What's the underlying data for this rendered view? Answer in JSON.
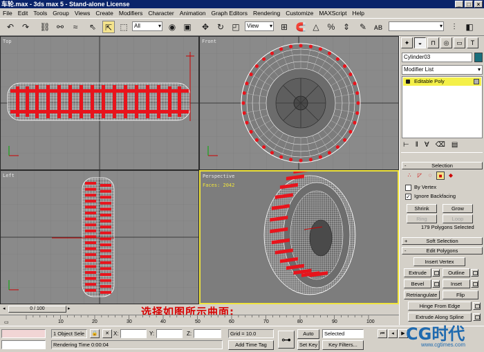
{
  "window": {
    "title": "车轮.max - 3ds max 5 - Stand-alone License",
    "controls": [
      "_",
      "□",
      "×"
    ]
  },
  "menu": [
    "File",
    "Edit",
    "Tools",
    "Group",
    "Views",
    "Create",
    "Modifiers",
    "Character",
    "Animation",
    "Graph Editors",
    "Rendering",
    "Customize",
    "MAXScript",
    "Help"
  ],
  "toolbar": {
    "selection_filter": "All",
    "reference_coord": "View"
  },
  "viewports": {
    "top": {
      "label": "Top"
    },
    "front": {
      "label": "Front"
    },
    "left": {
      "label": "Left"
    },
    "perspective": {
      "label": "Perspective",
      "faces": "Faces: 2042"
    }
  },
  "command_panel": {
    "object_name": "Cylinder03",
    "object_color": "#1a6f7c",
    "modifier_list": "Modifier List",
    "stack_item": "Editable Poly",
    "selection": {
      "title": "Selection",
      "by_vertex": "By Vertex",
      "by_vertex_checked": false,
      "ignore_backfacing": "Ignore Backfacing",
      "ignore_backfacing_checked": true,
      "shrink": "Shrink",
      "grow": "Grow",
      "ring": "Ring",
      "loop": "Loop",
      "status": "179 Polygons Selected"
    },
    "soft_selection": "Soft Selection",
    "edit_polygons": {
      "title": "Edit Polygons",
      "insert_vertex": "Insert Vertex",
      "extrude": "Extrude",
      "outline": "Outline",
      "bevel": "Bevel",
      "inset": "Inset",
      "retriangulate": "Retriangulate",
      "flip": "Flip",
      "hinge_from_edge": "Hinge From Edge",
      "extrude_along_spline": "Extrude Along Spline"
    }
  },
  "timeline": {
    "slider": "0 / 100",
    "ticks": [
      "0",
      "10",
      "20",
      "30",
      "40",
      "50",
      "60",
      "70",
      "80",
      "90",
      "100"
    ]
  },
  "annotation": "选择如图所示曲面:",
  "status": {
    "selection": "1 Object Sele",
    "x_label": "X:",
    "y_label": "Y:",
    "z_label": "Z:",
    "grid": "Grid = 10.0",
    "rendering_time": "Rendering Time  0:00:04",
    "add_time_tag": "Add Time Tag",
    "auto_key": "Auto Key",
    "set_key": "Set Key",
    "key_mode": "Selected",
    "key_filters": "Key Filters..."
  },
  "logo": {
    "text": "CG时代",
    "url": "www.cgtimes.com"
  }
}
